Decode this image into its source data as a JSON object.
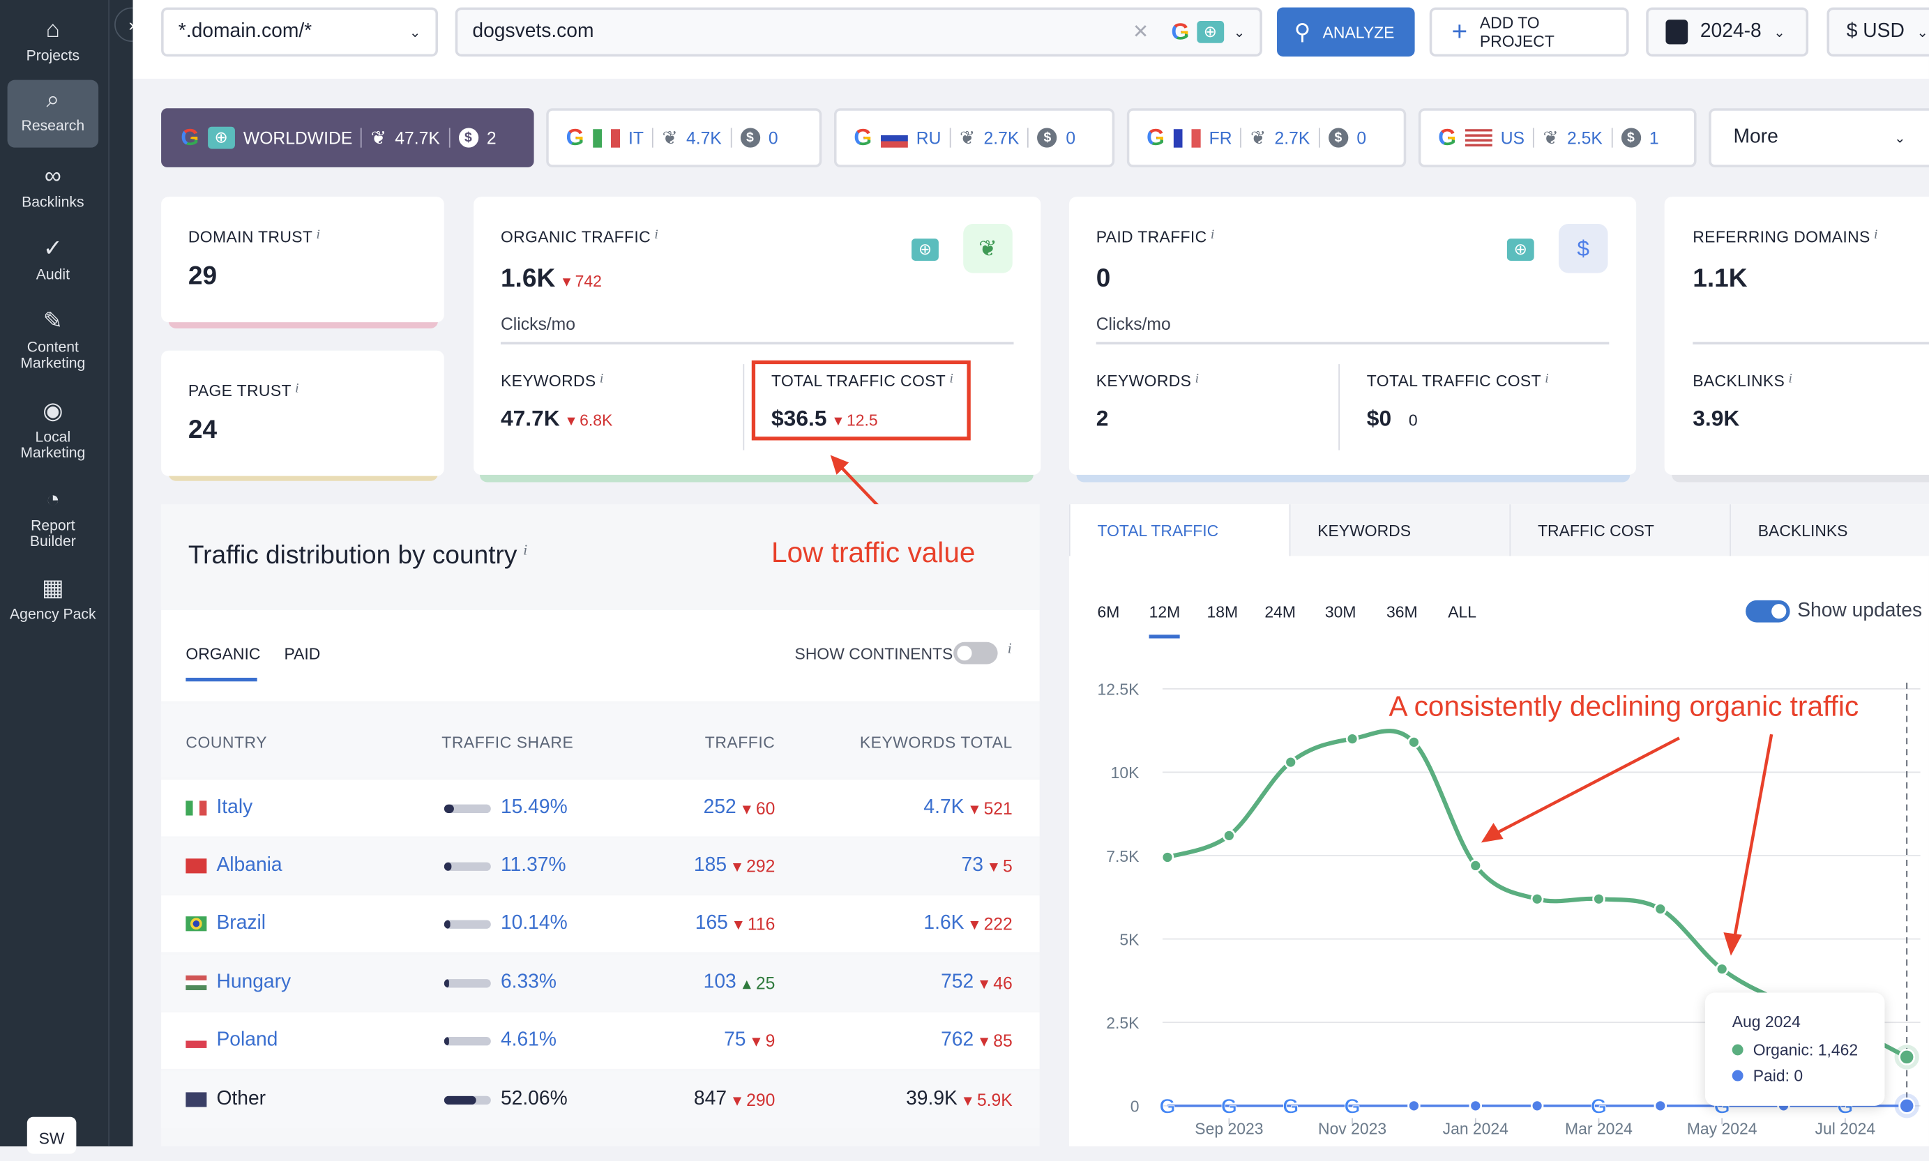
{
  "sidebar": {
    "items": [
      {
        "label": "Projects",
        "icon": "home-icon"
      },
      {
        "label": "Research",
        "icon": "research-icon",
        "active": true
      },
      {
        "label": "Backlinks",
        "icon": "link-icon"
      },
      {
        "label": "Audit",
        "icon": "check-circle-icon"
      },
      {
        "label": "Content Marketing",
        "icon": "edit-icon"
      },
      {
        "label": "Local Marketing",
        "icon": "location-pin-icon"
      },
      {
        "label": "Report Builder",
        "icon": "pie-chart-icon"
      },
      {
        "label": "Agency Pack",
        "icon": "building-icon"
      }
    ],
    "user_badge": "SW"
  },
  "topbar": {
    "scope": "*.domain.com/*",
    "search_value": "dogsvets.com",
    "analyze": "ANALYZE",
    "add_to_project": "ADD TO PROJECT",
    "date": "2024-8",
    "currency": "$ USD"
  },
  "databases": [
    {
      "code": "WORLDWIDE",
      "keywords": "47.7K",
      "paid": "2",
      "active": true
    },
    {
      "code": "IT",
      "keywords": "4.7K",
      "paid": "0"
    },
    {
      "code": "RU",
      "keywords": "2.7K",
      "paid": "0"
    },
    {
      "code": "FR",
      "keywords": "2.7K",
      "paid": "0"
    },
    {
      "code": "US",
      "keywords": "2.5K",
      "paid": "1"
    }
  ],
  "more": "More",
  "metrics": {
    "domain_trust": {
      "label": "DOMAIN TRUST",
      "value": "29"
    },
    "page_trust": {
      "label": "PAGE TRUST",
      "value": "24"
    },
    "organic": {
      "label": "ORGANIC TRAFFIC",
      "value": "1.6K",
      "delta": "742",
      "unit": "Clicks/mo",
      "keywords_label": "KEYWORDS",
      "keywords": "47.7K",
      "keywords_delta": "6.8K",
      "cost_label": "TOTAL TRAFFIC COST",
      "cost": "$36.5",
      "cost_delta": "12.5"
    },
    "paid": {
      "label": "PAID TRAFFIC",
      "value": "0",
      "unit": "Clicks/mo",
      "keywords_label": "KEYWORDS",
      "keywords": "2",
      "cost_label": "TOTAL TRAFFIC COST",
      "cost": "$0",
      "cost_delta": "0"
    },
    "referring": {
      "label": "REFERRING DOMAINS",
      "value": "1.1K",
      "backlinks_label": "BACKLINKS",
      "backlinks": "3.9K"
    },
    "info": "i"
  },
  "annotations": {
    "low_value": "Low traffic value",
    "declining": "A consistently declining organic traffic"
  },
  "distribution": {
    "title": "Traffic distribution by country",
    "tabs": [
      "ORGANIC",
      "PAID"
    ],
    "show_continents": "SHOW CONTINENTS",
    "columns": [
      "COUNTRY",
      "TRAFFIC SHARE",
      "TRAFFIC",
      "KEYWORDS TOTAL"
    ],
    "rows": [
      {
        "country": "Italy",
        "share": "15.49%",
        "share_pct": 15.49,
        "traffic": "252",
        "traffic_delta": "60",
        "traffic_dir": "down",
        "keywords": "4.7K",
        "keywords_delta": "521"
      },
      {
        "country": "Albania",
        "share": "11.37%",
        "share_pct": 11.37,
        "traffic": "185",
        "traffic_delta": "292",
        "traffic_dir": "down",
        "keywords": "73",
        "keywords_delta": "5"
      },
      {
        "country": "Brazil",
        "share": "10.14%",
        "share_pct": 10.14,
        "traffic": "165",
        "traffic_delta": "116",
        "traffic_dir": "down",
        "keywords": "1.6K",
        "keywords_delta": "222"
      },
      {
        "country": "Hungary",
        "share": "6.33%",
        "share_pct": 6.33,
        "traffic": "103",
        "traffic_delta": "25",
        "traffic_dir": "up",
        "keywords": "752",
        "keywords_delta": "46"
      },
      {
        "country": "Poland",
        "share": "4.61%",
        "share_pct": 4.61,
        "traffic": "75",
        "traffic_delta": "9",
        "traffic_dir": "down",
        "keywords": "762",
        "keywords_delta": "85"
      },
      {
        "country": "Other",
        "share": "52.06%",
        "share_pct": 52.06,
        "traffic": "847",
        "traffic_delta": "290",
        "traffic_dir": "down",
        "keywords": "39.9K",
        "keywords_delta": "5.9K"
      }
    ]
  },
  "trend": {
    "tabs": [
      "TOTAL TRAFFIC",
      "KEYWORDS",
      "TRAFFIC COST",
      "BACKLINKS"
    ],
    "periods": [
      "6M",
      "12M",
      "18M",
      "24M",
      "30M",
      "36M",
      "ALL"
    ],
    "active_period": "12M",
    "show_updates": "Show updates",
    "tooltip": {
      "title": "Aug 2024",
      "organic": "Organic: 1,462",
      "paid": "Paid: 0"
    }
  },
  "chart_data": {
    "type": "line",
    "x": [
      "Aug 2023",
      "Sep 2023",
      "Oct 2023",
      "Nov 2023",
      "Dec 2023",
      "Jan 2024",
      "Feb 2024",
      "Mar 2024",
      "Apr 2024",
      "May 2024",
      "Jun 2024",
      "Jul 2024",
      "Aug 2024"
    ],
    "x_tick_labels": [
      "Sep 2023",
      "Nov 2023",
      "Jan 2024",
      "Mar 2024",
      "May 2024",
      "Jul 2024"
    ],
    "y_tick_labels": [
      "0",
      "2.5K",
      "5K",
      "7.5K",
      "10K",
      "12.5K"
    ],
    "ylim": [
      0,
      12500
    ],
    "grid": true,
    "series": [
      {
        "name": "Organic",
        "color": "#5aae7f",
        "values": [
          7450,
          8100,
          10300,
          11000,
          10900,
          7200,
          6200,
          6200,
          5900,
          4100,
          3100,
          2400,
          1462
        ]
      },
      {
        "name": "Paid",
        "color": "#4f7fe8",
        "values": [
          0,
          0,
          0,
          0,
          0,
          0,
          0,
          0,
          0,
          0,
          0,
          0,
          0
        ]
      }
    ],
    "google_update_months": [
      "Aug 2023",
      "Sep 2023",
      "Oct 2023",
      "Nov 2023",
      "Mar 2024",
      "May 2024",
      "Jul 2024"
    ]
  }
}
